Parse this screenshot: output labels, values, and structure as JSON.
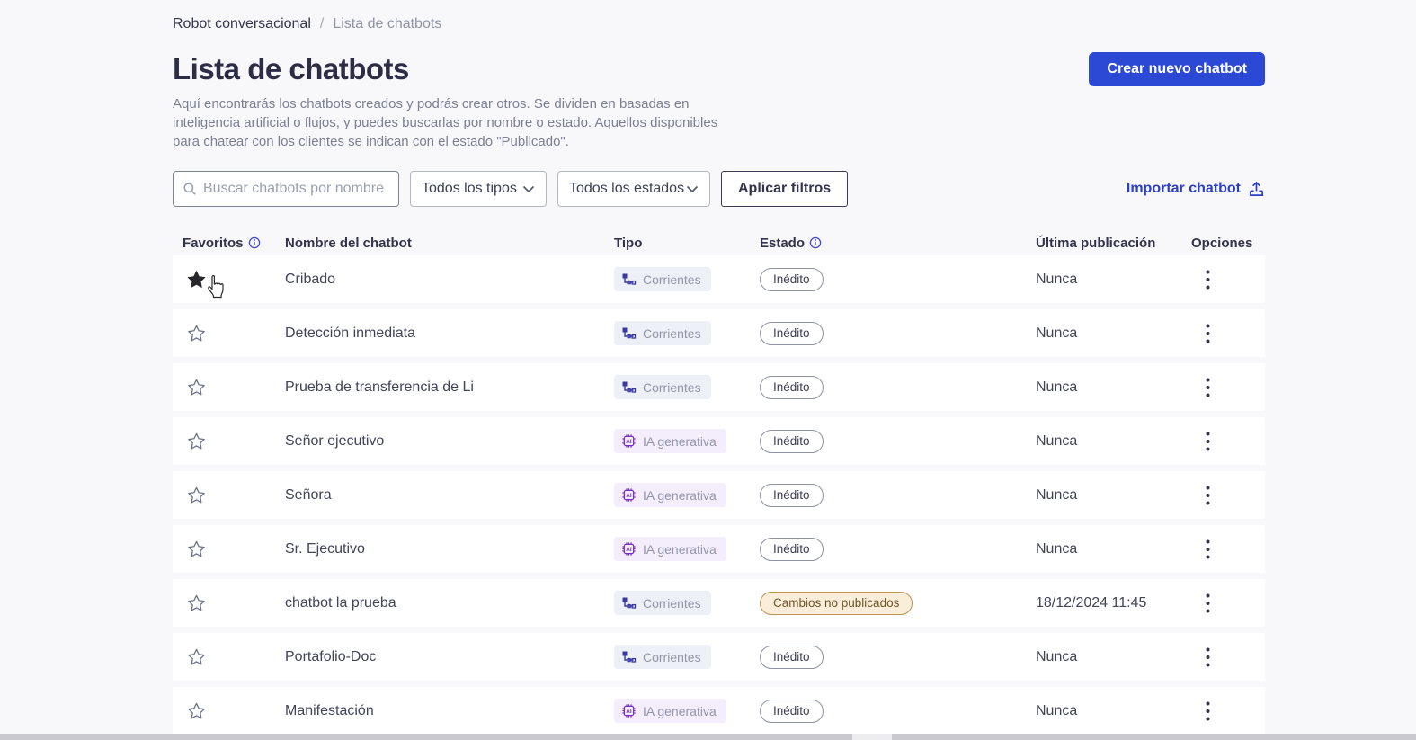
{
  "breadcrumb": {
    "parent": "Robot conversacional",
    "separator": "/",
    "current": "Lista de chatbots"
  },
  "header": {
    "title": "Lista de chatbots",
    "description": "Aquí encontrarás los chatbots creados y podrás crear otros. Se dividen en basadas en inteligencia artificial o flujos, y puedes buscarlas por nombre o estado. Aquellos disponibles para chatear con los clientes se indican con el estado \"Publicado\".",
    "create_button": "Crear nuevo chatbot"
  },
  "filters": {
    "search_placeholder": "Buscar chatbots por nombre",
    "search_value": "",
    "type_select": "Todos los tipos",
    "status_select": "Todos los estados",
    "apply_button": "Aplicar filtros",
    "import_link": "Importar chatbot"
  },
  "table": {
    "headers": {
      "favorites": "Favoritos",
      "name": "Nombre del chatbot",
      "type": "Tipo",
      "status": "Estado",
      "last_published": "Última publicación",
      "options": "Opciones"
    },
    "type_labels": {
      "flow": "Corrientes",
      "ai": "IA generativa"
    },
    "rows": [
      {
        "name": "Cribado",
        "type_kind": "flow",
        "type": "Corrientes",
        "status": "Inédito",
        "status_kind": "draft",
        "last_published": "Nunca",
        "favorite": true
      },
      {
        "name": "Detección inmediata",
        "type_kind": "flow",
        "type": "Corrientes",
        "status": "Inédito",
        "status_kind": "draft",
        "last_published": "Nunca",
        "favorite": false
      },
      {
        "name": "Prueba de transferencia de Li",
        "type_kind": "flow",
        "type": "Corrientes",
        "status": "Inédito",
        "status_kind": "draft",
        "last_published": "Nunca",
        "favorite": false
      },
      {
        "name": "Señor ejecutivo",
        "type_kind": "ai",
        "type": "IA generativa",
        "status": "Inédito",
        "status_kind": "draft",
        "last_published": "Nunca",
        "favorite": false
      },
      {
        "name": "Señora",
        "type_kind": "ai",
        "type": "IA generativa",
        "status": "Inédito",
        "status_kind": "draft",
        "last_published": "Nunca",
        "favorite": false
      },
      {
        "name": "Sr. Ejecutivo",
        "type_kind": "ai",
        "type": "IA generativa",
        "status": "Inédito",
        "status_kind": "draft",
        "last_published": "Nunca",
        "favorite": false
      },
      {
        "name": "chatbot la prueba",
        "type_kind": "flow",
        "type": "Corrientes",
        "status": "Cambios no publicados",
        "status_kind": "changes",
        "last_published": "18/12/2024 11:45",
        "favorite": false
      },
      {
        "name": "Portafolio-Doc",
        "type_kind": "flow",
        "type": "Corrientes",
        "status": "Inédito",
        "status_kind": "draft",
        "last_published": "Nunca",
        "favorite": false
      },
      {
        "name": "Manifestación",
        "type_kind": "ai",
        "type": "IA generativa",
        "status": "Inédito",
        "status_kind": "draft",
        "last_published": "Nunca",
        "favorite": false
      }
    ]
  },
  "colors": {
    "primary_button": "#2c49d5",
    "link": "#2b3fc4",
    "flow_icon": "#3939a0",
    "ai_icon": "#7a2fc2",
    "changes_badge_bg": "#faeeda",
    "changes_badge_border": "#bb9355",
    "changes_badge_text": "#6e5426",
    "page_background": "#f8f8fa",
    "row_background": "#ffffff"
  }
}
